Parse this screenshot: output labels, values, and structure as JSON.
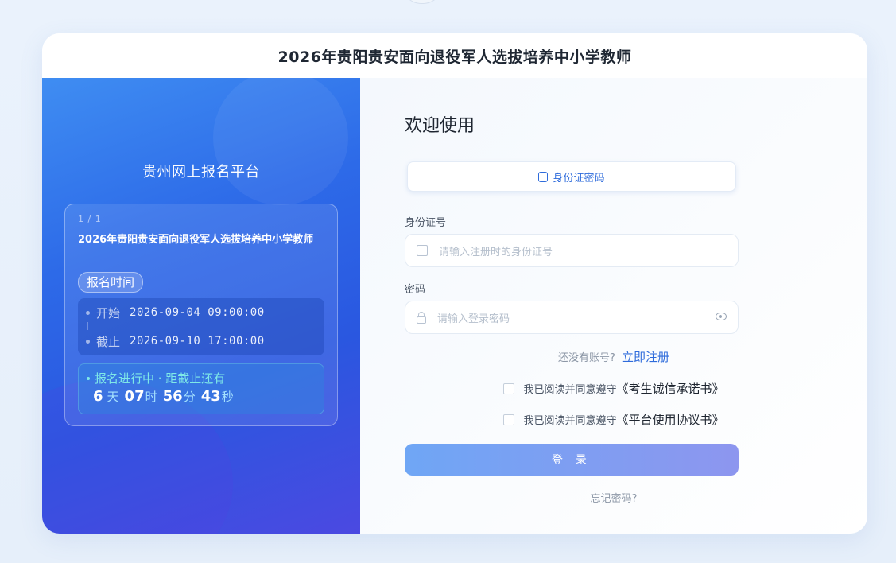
{
  "header": {
    "title": "2026年贵阳贵安面向退役军人选拔培养中小学教师"
  },
  "left": {
    "platform_title": "贵州网上报名平台",
    "notice": {
      "pager": "1 / 1",
      "title": "2026年贵阳贵安面向退役军人选拔培养中小学教师",
      "badge": "报名时间",
      "start_label": "开始",
      "start_value": "2026-09-04 09:00:00",
      "end_label": "截止",
      "end_value": "2026-09-10 17:00:00",
      "status": "报名进行中 · 距截止还有",
      "countdown": {
        "days": "6",
        "days_unit": "天",
        "hours": "07",
        "hours_unit": "时",
        "minutes": "56",
        "minutes_unit": "分",
        "seconds": "43",
        "seconds_unit": "秒"
      }
    }
  },
  "form": {
    "welcome": "欢迎使用",
    "tab_label": "身份证密码",
    "id_label": "身份证号",
    "id_placeholder": "请输入注册时的身份证号",
    "pwd_label": "密码",
    "pwd_placeholder": "请输入登录密码",
    "no_account": "还没有账号?",
    "register_link": "立即注册",
    "agree_prefix": "我已阅读并同意遵守",
    "agree_doc1": "《考生诚信承诺书》",
    "agree_doc2": "《平台使用协议书》",
    "login_label": "登 录",
    "forgot": "忘记密码?"
  },
  "colors": {
    "accent": "#2e6bdb",
    "panel_start": "#3f8df2",
    "panel_end": "#4b49e1",
    "countdown": "#7fe9e7"
  }
}
